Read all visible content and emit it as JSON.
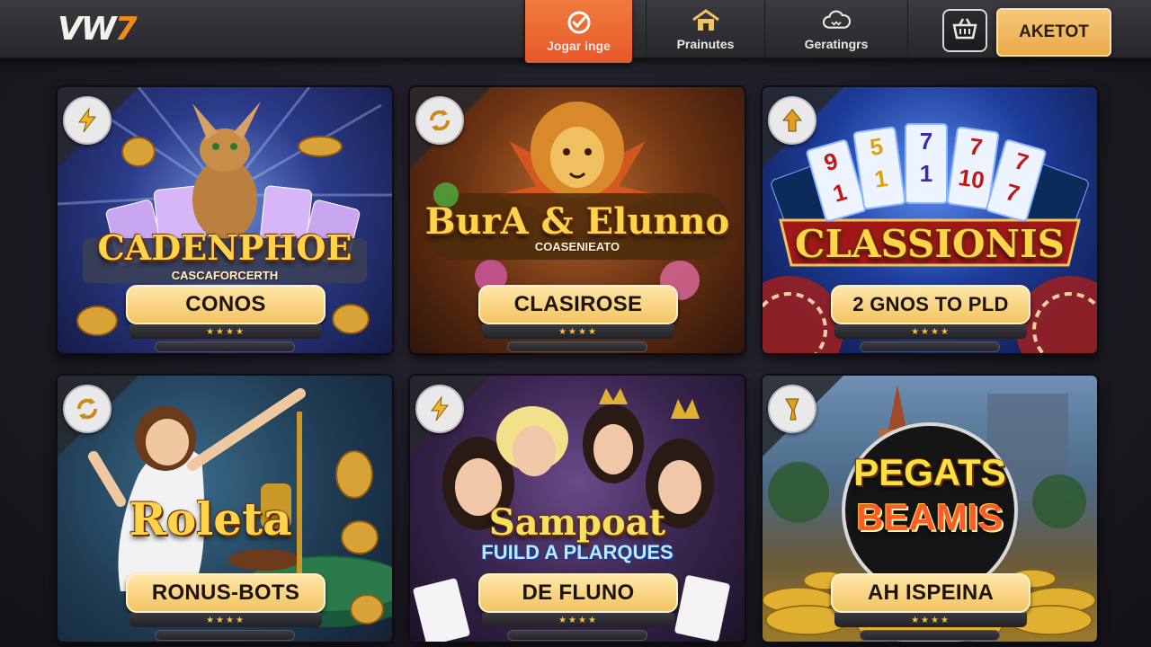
{
  "header": {
    "logo_main": "VW",
    "logo_accent": "7",
    "tabs": [
      {
        "label": "Jogar inge",
        "icon": "check-badge-icon",
        "active": true
      },
      {
        "label": "Prainutes",
        "icon": "house-icon",
        "active": false
      },
      {
        "label": "Geratingrs",
        "icon": "cloud-icon",
        "active": false
      }
    ],
    "basket_icon": "basket-icon",
    "cta_label": "AKETOT"
  },
  "colors": {
    "accent_orange": "#e6592b",
    "gold": "#f3c463",
    "header_bg": "#2f2f34"
  },
  "cards": [
    {
      "badge_icon": "lightning-icon",
      "art_title": "CADENPHOE",
      "art_sub": "CASCAFORCERTH",
      "label": "CONOS",
      "stars": "★★★★"
    },
    {
      "badge_icon": "refresh-icon",
      "art_title": "BurA & Elunno",
      "art_sub": "COASENIEATO",
      "label": "CLASIROSE",
      "stars": "★★★★"
    },
    {
      "badge_icon": "arrow-up-icon",
      "art_title": "CLASSIONIS",
      "art_sub": "",
      "label": "2 GNOS TO PLD",
      "stars": "★★★★",
      "card_numbers": [
        "9",
        "5",
        "7",
        "7",
        "7"
      ],
      "card_numbers_low": [
        "1",
        "1",
        "1",
        "10",
        "7"
      ]
    },
    {
      "badge_icon": "refresh-icon",
      "art_title": "Roleta",
      "art_sub": "",
      "label": "RONUS-BOTS",
      "stars": "★★★★"
    },
    {
      "badge_icon": "lightning-icon",
      "art_title": "Sampoat",
      "art_sub": "FUILD A PLARQUES",
      "label": "DE FLUNO",
      "stars": "★★★★"
    },
    {
      "badge_icon": "pointer-icon",
      "art_title": "PEGATS",
      "art_sub": "BEAMIS",
      "label": "AH ISPEINA",
      "stars": "★★★★"
    }
  ]
}
